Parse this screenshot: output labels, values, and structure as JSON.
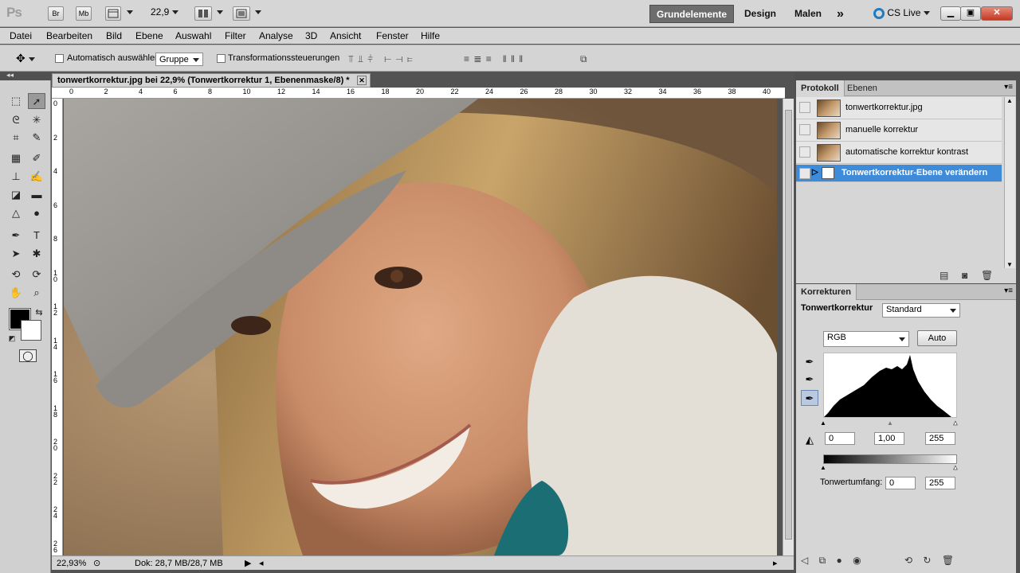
{
  "appbar": {
    "logo": "Ps",
    "bridge": "Br",
    "minibridge": "Mb",
    "zoom": "22,9",
    "workspaces": [
      "Grundelemente",
      "Design",
      "Malen"
    ],
    "more": "»",
    "cslive": "CS Live"
  },
  "menu": [
    "Datei",
    "Bearbeiten",
    "Bild",
    "Ebene",
    "Auswahl",
    "Filter",
    "Analyse",
    "3D",
    "Ansicht",
    "Fenster",
    "Hilfe"
  ],
  "options": {
    "auto_select_label": "Automatisch auswählen:",
    "auto_select_value": "Gruppe",
    "transform_label": "Transformationssteuerungen"
  },
  "document": {
    "tab_title": "tonwertkorrektur.jpg bei 22,9% (Tonwertkorrektur 1, Ebenenmaske/8) *",
    "ruler_h": [
      "0",
      "2",
      "4",
      "6",
      "8",
      "10",
      "12",
      "14",
      "16",
      "18",
      "20",
      "22",
      "24",
      "26",
      "28",
      "30",
      "32",
      "34",
      "36",
      "38",
      "40"
    ],
    "ruler_v": [
      "0",
      "2",
      "4",
      "6",
      "8",
      "1\n0",
      "1\n2",
      "1\n4",
      "1\n6",
      "1\n8",
      "2\n0",
      "2\n2",
      "2\n4",
      "2\n6"
    ],
    "status_zoom": "22,93%",
    "status_doc": "Dok: 28,7 MB/28,7 MB"
  },
  "history_panel": {
    "tabs": [
      "Protokoll",
      "Ebenen"
    ],
    "items": [
      {
        "label": "tonwertkorrektur.jpg"
      },
      {
        "label": "manuelle korrektur"
      },
      {
        "label": "automatische korrektur kontrast"
      },
      {
        "label": "Tonwertkorrektur-Ebene verändern"
      }
    ]
  },
  "korrekturen": {
    "tab": "Korrekturen",
    "title": "Tonwertkorrektur",
    "preset": "Standard",
    "channel": "RGB",
    "auto": "Auto",
    "input_black": "0",
    "input_gamma": "1,00",
    "input_white": "255",
    "output_label": "Tonwertumfang:",
    "output_black": "0",
    "output_white": "255"
  },
  "colors": {
    "selection": "#3d8bd9",
    "active_workspace": "#6d6d6d"
  }
}
